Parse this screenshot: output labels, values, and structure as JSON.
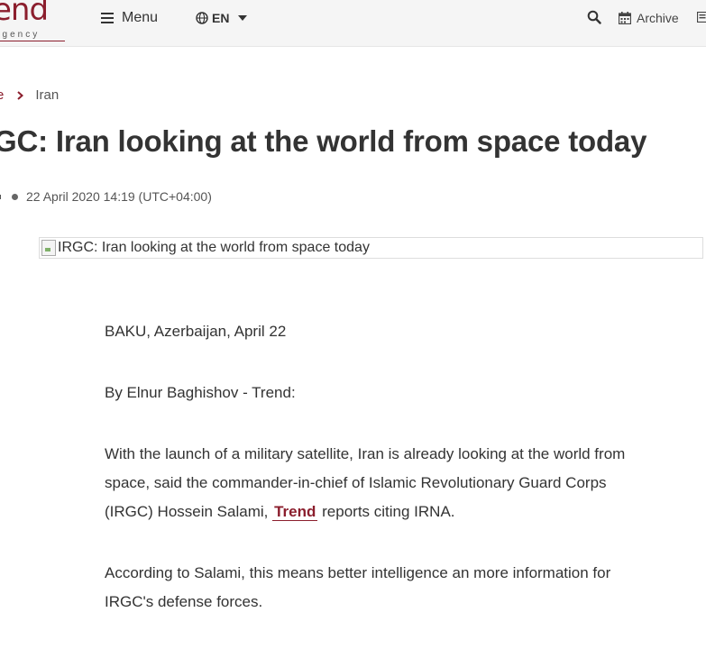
{
  "header": {
    "logo_text": "end",
    "logo_subtext": "agency",
    "menu_label": "Menu",
    "language": "EN",
    "archive_label": "Archive"
  },
  "icons": {
    "menu": "hamburger-icon",
    "language": "globe-icon",
    "dropdown": "caret-down-icon",
    "search": "search-icon",
    "archive": "calendar-icon"
  },
  "breadcrumb": {
    "home": "e",
    "current": "Iran"
  },
  "article": {
    "title": "GC: Iran looking at the world from space today",
    "date": "22 April 2020 14:19 (UTC+04:00)",
    "image_alt": "IRGC: Iran looking at the world from space today",
    "dateline": "BAKU, Azerbaijan, April 22",
    "byline": "By Elnur Baghishov - Trend:",
    "p1_before": "With the launch of a military satellite, Iran is already looking at the world from space, said the commander-in-chief of Islamic Revolutionary Guard Corps (IRGC) Hossein Salami, ",
    "p1_link": "Trend",
    "p1_after": " reports citing IRNA.",
    "p2": "According to Salami, this means better intelligence an more information for IRGC's defense forces."
  },
  "colors": {
    "brand": "#8b1e2d",
    "text": "#333333",
    "header_bg": "#f5f5f5"
  }
}
